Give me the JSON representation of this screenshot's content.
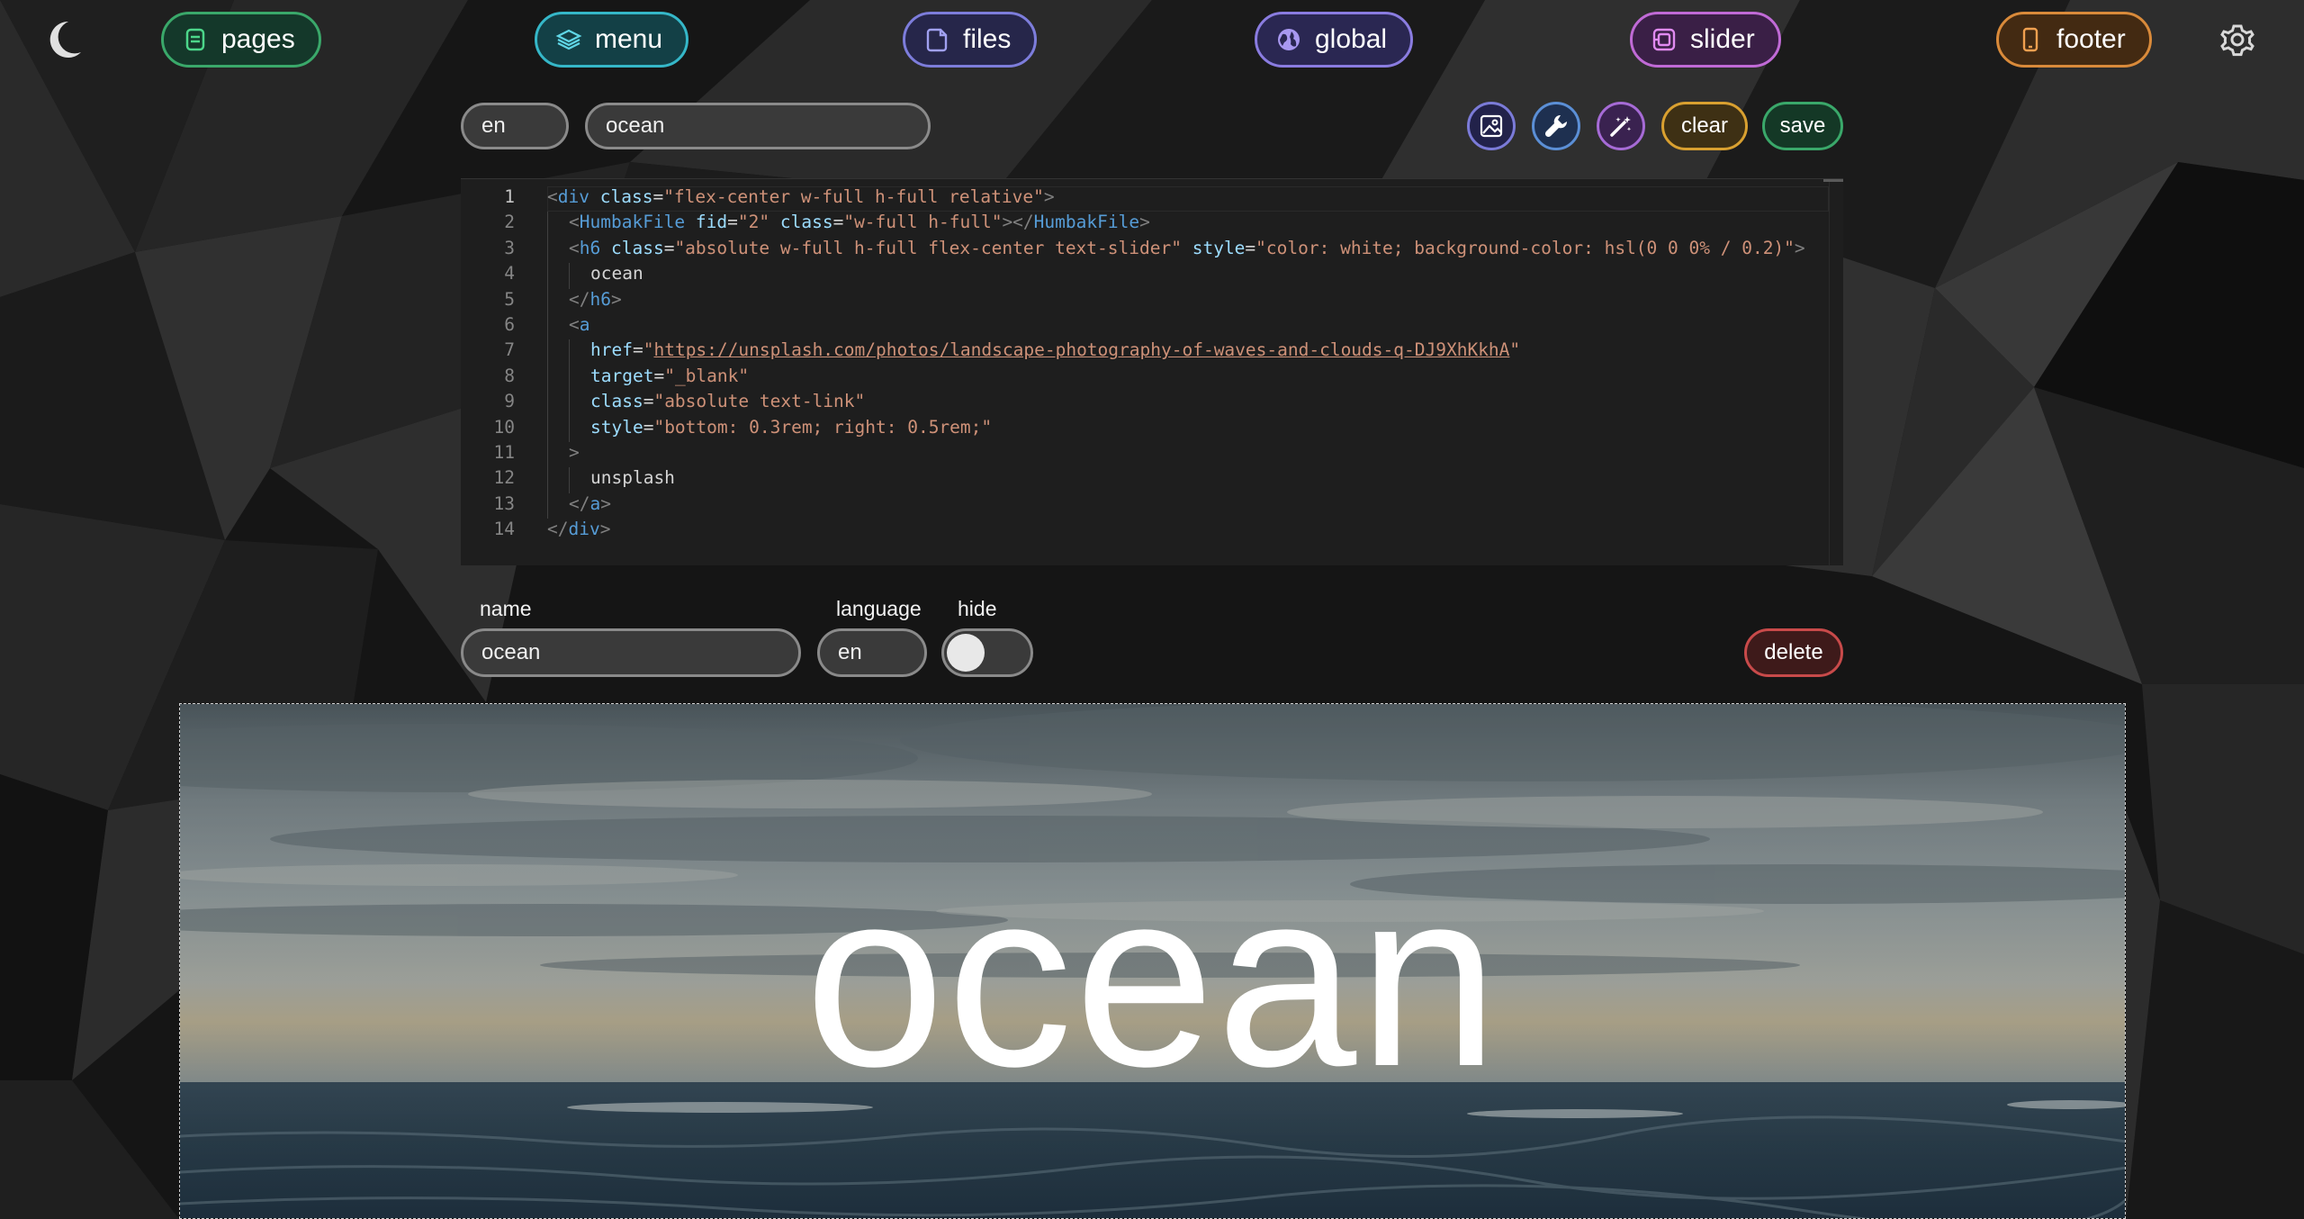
{
  "nav": {
    "pages": "pages",
    "menu": "menu",
    "files": "files",
    "global": "global",
    "slider": "slider",
    "footer": "footer"
  },
  "toolbar": {
    "language_value": "en",
    "search_value": "ocean",
    "clear_label": "clear",
    "save_label": "save"
  },
  "editor": {
    "lines": [
      [
        [
          "t-punc",
          "<"
        ],
        [
          "t-tag",
          "div"
        ],
        [
          "t-eq",
          " "
        ],
        [
          "t-attr",
          "class"
        ],
        [
          "t-eq",
          "="
        ],
        [
          "t-str",
          "\"flex-center w-full h-full relative\""
        ],
        [
          "t-punc",
          ">"
        ]
      ],
      [
        [
          "t-punc",
          "<"
        ],
        [
          "t-tag",
          "HumbakFile"
        ],
        [
          "t-eq",
          " "
        ],
        [
          "t-attr",
          "fid"
        ],
        [
          "t-eq",
          "="
        ],
        [
          "t-str",
          "\"2\""
        ],
        [
          "t-eq",
          " "
        ],
        [
          "t-attr",
          "class"
        ],
        [
          "t-eq",
          "="
        ],
        [
          "t-str",
          "\"w-full h-full\""
        ],
        [
          "t-punc",
          "></"
        ],
        [
          "t-tag",
          "HumbakFile"
        ],
        [
          "t-punc",
          ">"
        ]
      ],
      [
        [
          "t-punc",
          "<"
        ],
        [
          "t-tag",
          "h6"
        ],
        [
          "t-eq",
          " "
        ],
        [
          "t-attr",
          "class"
        ],
        [
          "t-eq",
          "="
        ],
        [
          "t-str",
          "\"absolute w-full h-full flex-center text-slider\""
        ],
        [
          "t-eq",
          " "
        ],
        [
          "t-attr",
          "style"
        ],
        [
          "t-eq",
          "="
        ],
        [
          "t-str",
          "\"color: white; background-color: hsl(0 0 0% / 0.2)\""
        ],
        [
          "t-punc",
          ">"
        ]
      ],
      [
        [
          "t-text",
          "ocean"
        ]
      ],
      [
        [
          "t-punc",
          "</"
        ],
        [
          "t-tag",
          "h6"
        ],
        [
          "t-punc",
          ">"
        ]
      ],
      [
        [
          "t-punc",
          "<"
        ],
        [
          "t-tag",
          "a"
        ]
      ],
      [
        [
          "t-attr",
          "href"
        ],
        [
          "t-eq",
          "="
        ],
        [
          "t-str",
          "\""
        ],
        [
          "t-link",
          "https://unsplash.com/photos/landscape-photography-of-waves-and-clouds-q-DJ9XhKkhA"
        ],
        [
          "t-str",
          "\""
        ]
      ],
      [
        [
          "t-attr",
          "target"
        ],
        [
          "t-eq",
          "="
        ],
        [
          "t-str",
          "\"_blank\""
        ]
      ],
      [
        [
          "t-attr",
          "class"
        ],
        [
          "t-eq",
          "="
        ],
        [
          "t-str",
          "\"absolute text-link\""
        ]
      ],
      [
        [
          "t-attr",
          "style"
        ],
        [
          "t-eq",
          "="
        ],
        [
          "t-str",
          "\"bottom: 0.3rem; right: 0.5rem;\""
        ]
      ],
      [
        [
          "t-punc",
          ">"
        ]
      ],
      [
        [
          "t-text",
          "unsplash"
        ]
      ],
      [
        [
          "t-punc",
          "</"
        ],
        [
          "t-tag",
          "a"
        ],
        [
          "t-punc",
          ">"
        ]
      ],
      [
        [
          "t-punc",
          "</"
        ],
        [
          "t-tag",
          "div"
        ],
        [
          "t-punc",
          ">"
        ]
      ]
    ],
    "indent_levels": [
      0,
      1,
      1,
      2,
      1,
      1,
      2,
      2,
      2,
      2,
      1,
      2,
      1,
      0
    ],
    "line_numbers": [
      "1",
      "2",
      "3",
      "4",
      "5",
      "6",
      "7",
      "8",
      "9",
      "10",
      "11",
      "12",
      "13",
      "14"
    ]
  },
  "form": {
    "name_label": "name",
    "name_value": "ocean",
    "language_label": "language",
    "language_value": "en",
    "hide_label": "hide",
    "hide_on": false,
    "delete_label": "delete"
  },
  "preview": {
    "title": "ocean"
  },
  "colors": {
    "pages": "#3aa86a",
    "menu": "#35b7c8",
    "files": "#7d7ddb",
    "global": "#8a7ce0",
    "slider": "#c06ad6",
    "footer": "#d98a3a",
    "image_btn": "#7b7bd8",
    "wrench_btn": "#5b8fd6",
    "magic_btn": "#a66bd6",
    "clear": "#d9a030",
    "save": "#3aa86a",
    "delete": "#c84a4a"
  },
  "icons": [
    "moon-icon",
    "settings-gear-icon",
    "document-icon",
    "layers-icon",
    "file-icon",
    "globe-icon",
    "slider-icon",
    "phone-icon",
    "image-icon",
    "wrench-icon",
    "magic-wand-icon"
  ]
}
